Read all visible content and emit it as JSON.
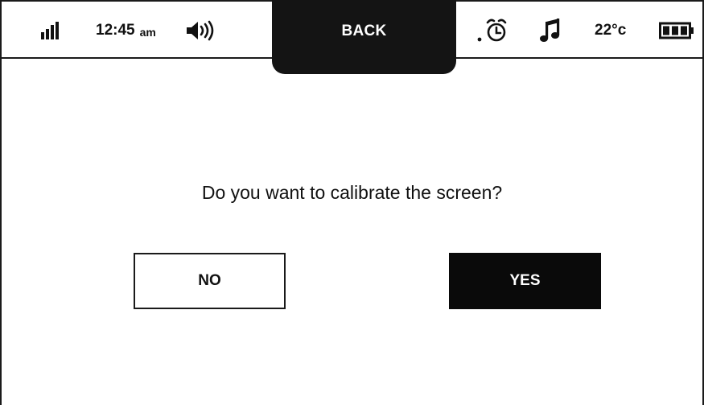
{
  "status_bar": {
    "signal_icon": "signal-bars-icon",
    "time": "12:45",
    "ampm": "am",
    "volume_icon": "speaker-volume-icon",
    "back_label": "BACK",
    "alarm_icon": "alarm-clock-icon",
    "music_icon": "music-note-icon",
    "temperature": "22°c",
    "battery_icon": "battery-full-icon"
  },
  "dialog": {
    "prompt": "Do you want to calibrate the screen?",
    "no_label": "NO",
    "yes_label": "YES"
  },
  "colors": {
    "background": "#ffffff",
    "foreground": "#111111",
    "accent_dark": "#0a0a0a"
  }
}
